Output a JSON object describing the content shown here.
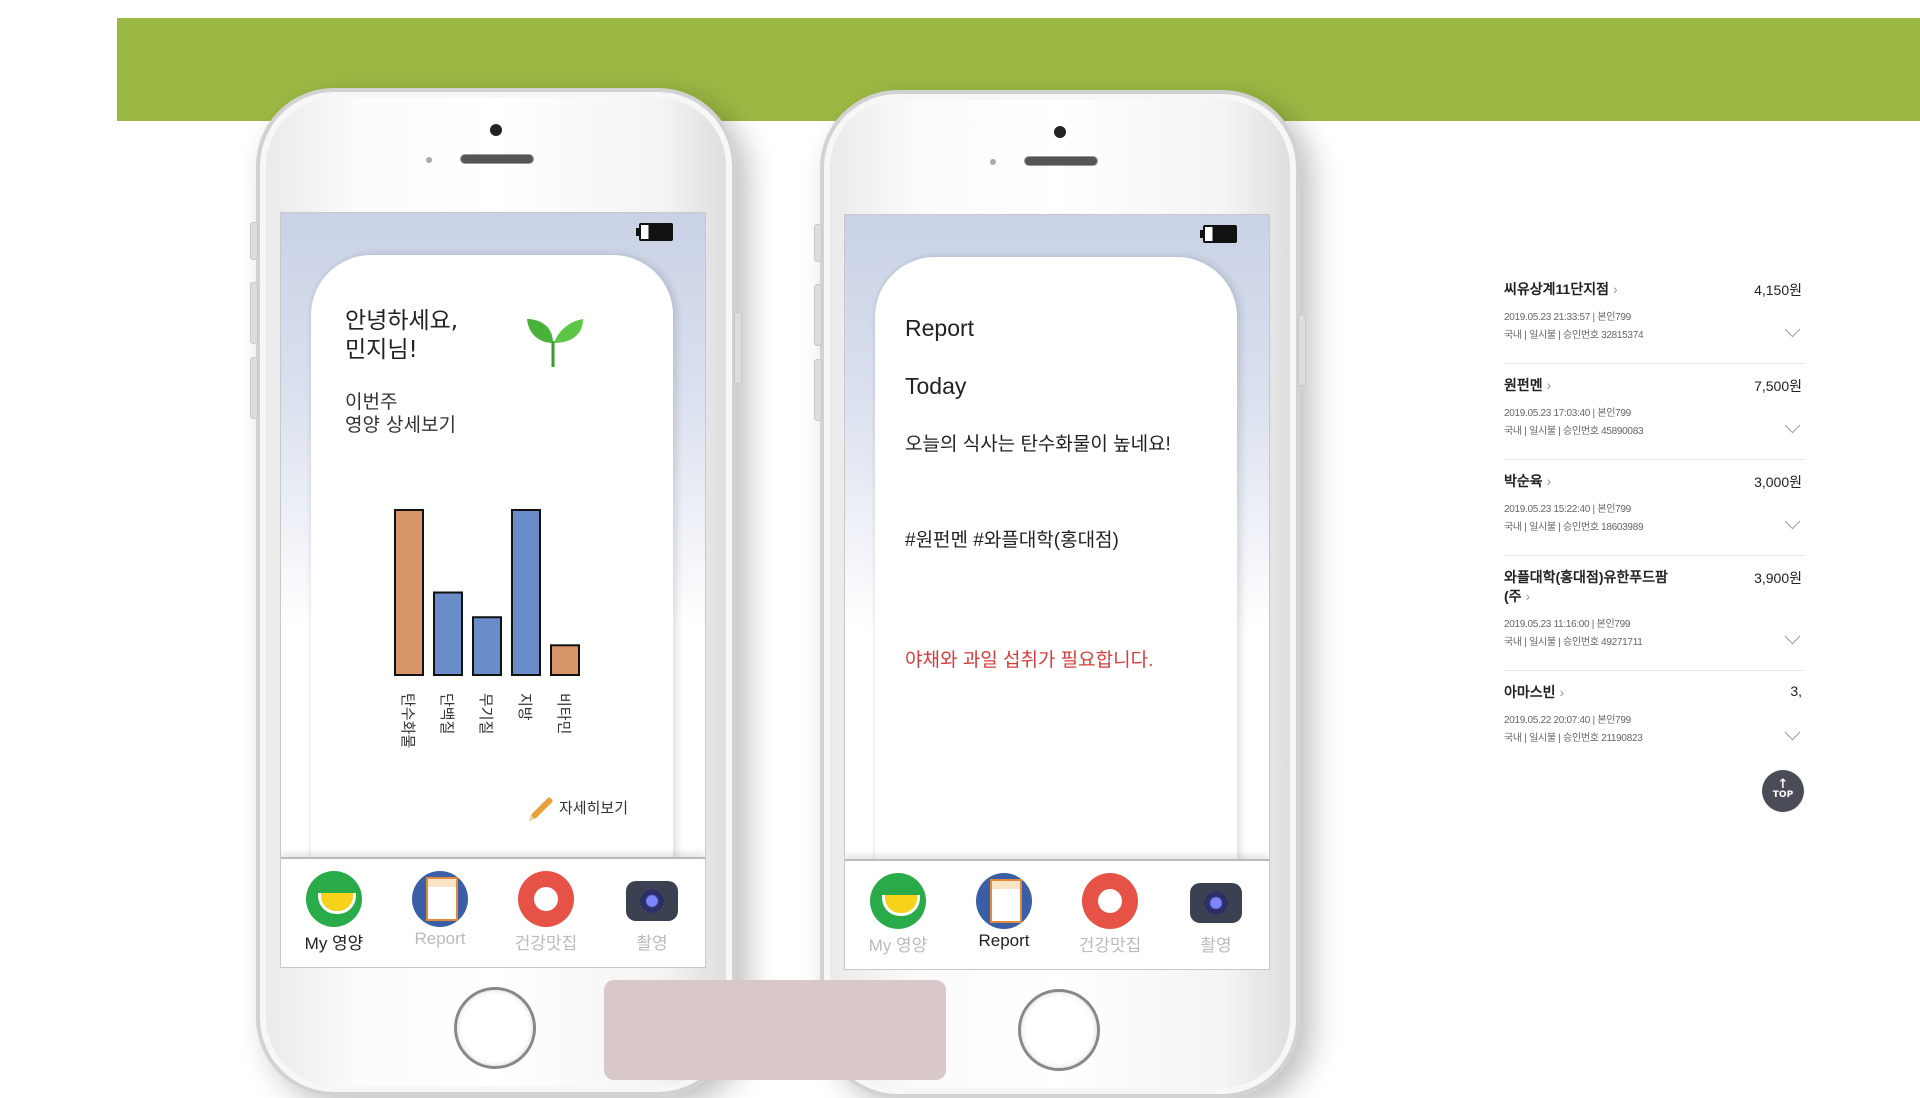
{
  "left_phone": {
    "greeting": "안녕하세요,\n민지님!",
    "weekly_link": "이번주\n영양 상세보기",
    "detail_link": "자세히보기",
    "tabs": [
      {
        "label": "My 영양",
        "icon": "lemon-icon",
        "active": true
      },
      {
        "label": "Report",
        "icon": "report-icon",
        "active": false
      },
      {
        "label": "건강맛집",
        "icon": "food-icon",
        "active": false
      },
      {
        "label": "촬영",
        "icon": "camera-icon",
        "active": false
      }
    ]
  },
  "right_phone": {
    "report_title": "Report",
    "today_label": "Today",
    "summary": "오늘의 식사는 탄수화물이 높네요!",
    "tags": "#원펀멘 #와플대학(홍대점)",
    "advice": "야채와 과일 섭취가 필요합니다.",
    "tabs": [
      {
        "label": "My 영양",
        "icon": "lemon-icon",
        "active": false
      },
      {
        "label": "Report",
        "icon": "report-icon",
        "active": true
      },
      {
        "label": "건강맛집",
        "icon": "food-icon",
        "active": false
      },
      {
        "label": "촬영",
        "icon": "camera-icon",
        "active": false
      }
    ]
  },
  "chart_data": {
    "type": "bar",
    "categories": [
      "탄수화물",
      "단백질",
      "무기질",
      "지방",
      "비타민"
    ],
    "values": [
      100,
      50,
      35,
      100,
      18
    ],
    "colors": [
      "#d9956a",
      "#6a8cc8",
      "#6a8cc8",
      "#6a8cc8",
      "#d9956a"
    ],
    "ylim": [
      0,
      100
    ],
    "title": "",
    "xlabel": "",
    "ylabel": ""
  },
  "transactions": [
    {
      "name": "씨유상계11단지점",
      "amount": "4,150원",
      "date": "2019.05.23 21:33:57",
      "approval_type": "본인799",
      "region": "국내",
      "installment": "일시불",
      "approval_no": "승인번호 32815374"
    },
    {
      "name": "원펀멘",
      "amount": "7,500원",
      "date": "2019.05.23 17:03:40",
      "approval_type": "본인799",
      "region": "국내",
      "installment": "일시불",
      "approval_no": "승인번호 45890083"
    },
    {
      "name": "박순육",
      "amount": "3,000원",
      "date": "2019.05.23 15:22:40",
      "approval_type": "본인799",
      "region": "국내",
      "installment": "일시불",
      "approval_no": "승인번호 18603989"
    },
    {
      "name": "와플대학(홍대점)유한푸드팜(주",
      "amount": "3,900원",
      "date": "2019.05.23 11:16:00",
      "approval_type": "본인799",
      "region": "국내",
      "installment": "일시불",
      "approval_no": "승인번호 49271711"
    },
    {
      "name": "아마스빈",
      "amount": "3,",
      "date": "2019.05.22 20:07:40",
      "approval_type": "본인799",
      "region": "국내",
      "installment": "일시불",
      "approval_no": "승인번호 21190823"
    }
  ],
  "top_button": {
    "arrow": "↑",
    "label": "TOP"
  },
  "colors": {
    "band": "#9cb944",
    "advice": "#d63c3c",
    "pink_block": "#d9c8c8"
  }
}
